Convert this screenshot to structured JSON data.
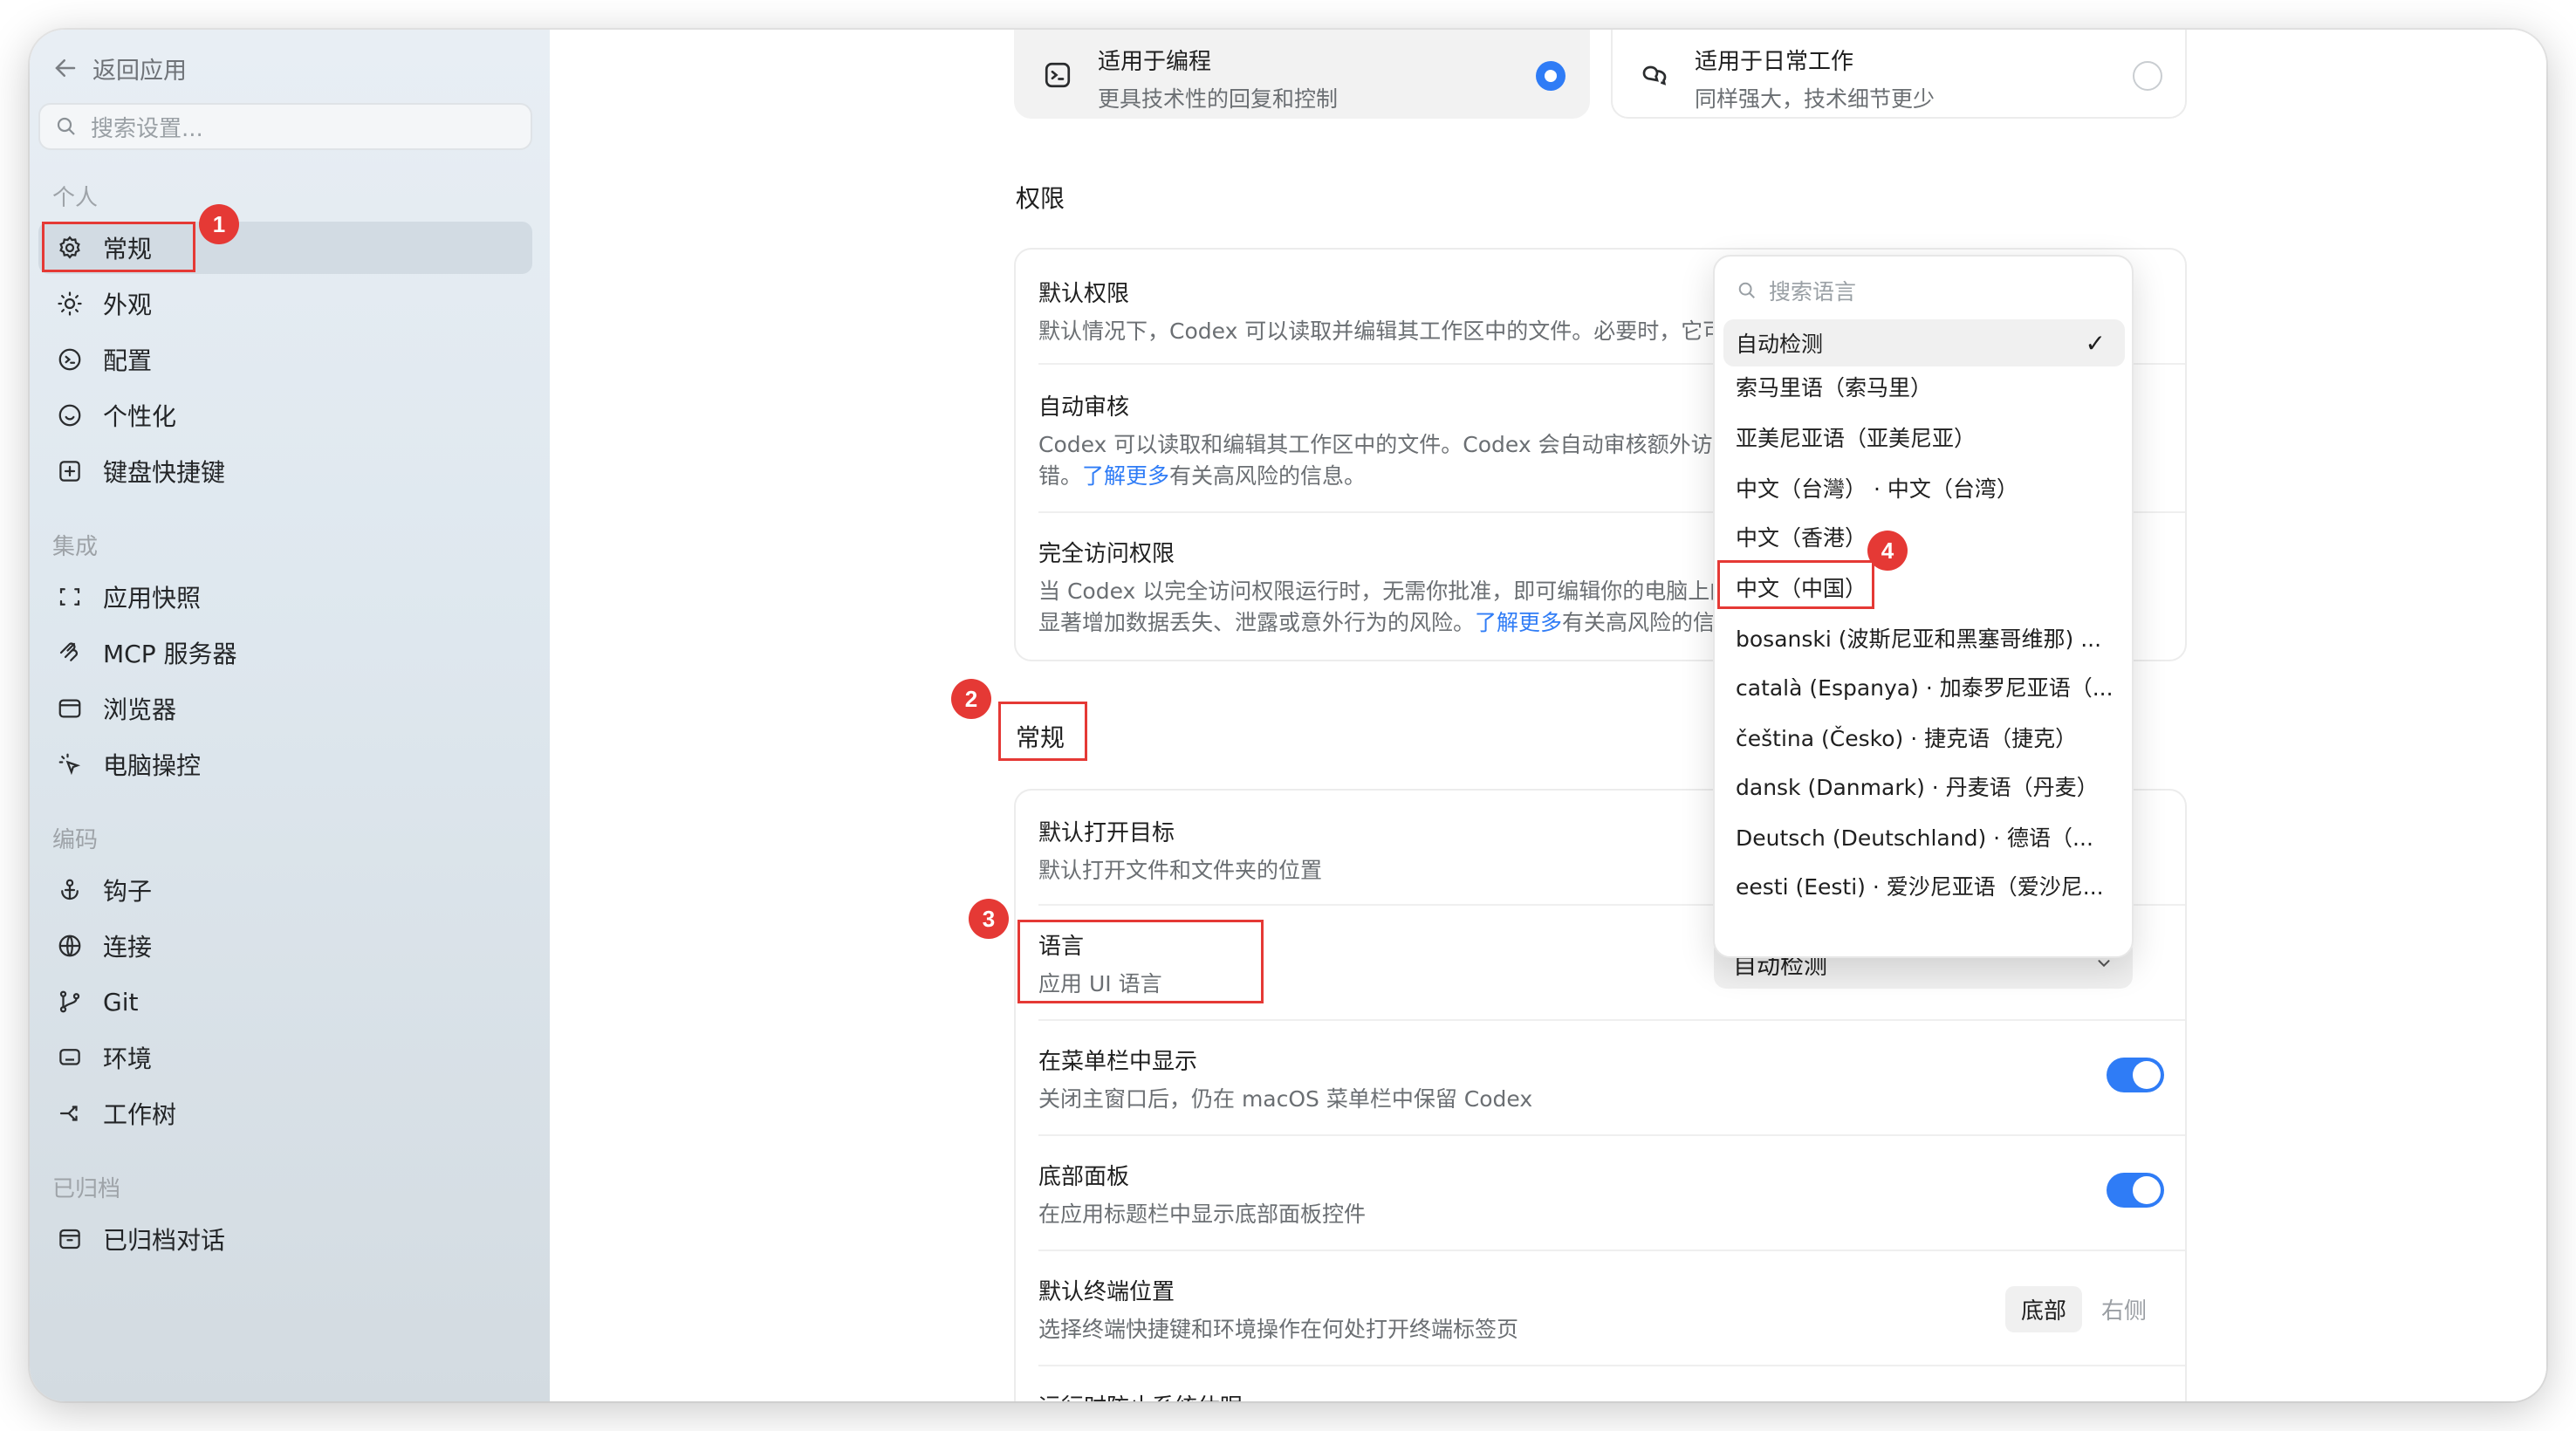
{
  "sidebar": {
    "back_label": "返回应用",
    "search_placeholder": "搜索设置...",
    "sections": {
      "personal": "个人",
      "integration": "集成",
      "coding": "编码",
      "archived": "已归档"
    },
    "items": {
      "general": "常规",
      "appearance": "外观",
      "config": "配置",
      "personalize": "个性化",
      "shortcuts": "键盘快捷键",
      "snapshots": "应用快照",
      "mcp": "MCP 服务器",
      "browser": "浏览器",
      "computer": "电脑操控",
      "hooks": "钩子",
      "connect": "连接",
      "git": "Git",
      "env": "环境",
      "worktree": "工作树",
      "archived_chats": "已归档对话"
    }
  },
  "mode_options": {
    "coding": {
      "title": "适用于编程",
      "desc": "更具技术性的回复和控制"
    },
    "daily": {
      "title": "适用于日常工作",
      "desc": "同样强大，技术细节更少"
    }
  },
  "permissions": {
    "heading": "权限",
    "default": {
      "title": "默认权限",
      "desc": "默认情况下，Codex 可以读取并编辑其工作区中的文件。必要时，它可"
    },
    "auto": {
      "title": "自动审核",
      "desc1": "Codex 可以读取和编辑其工作区中的文件。Codex 会自动审核额外访问",
      "desc2_pre": "错。",
      "link": "了解更多",
      "desc2_post": "有关高风险的信息。"
    },
    "full": {
      "title": "完全访问权限",
      "desc1": "当 Codex 以完全访问权限运行时，无需你批准，即可编辑你的电脑上的",
      "desc2_pre": "显著增加数据丢失、泄露或意外行为的风险。",
      "link": "了解更多",
      "desc2_post": "有关高风险的信息"
    }
  },
  "general": {
    "heading": "常规",
    "open_target": {
      "title": "默认打开目标",
      "desc": "默认打开文件和文件夹的位置"
    },
    "language": {
      "title": "语言",
      "desc": "应用 UI 语言",
      "value": "自动检测"
    },
    "menubar": {
      "title": "在菜单栏中显示",
      "desc": "关闭主窗口后，仍在 macOS 菜单栏中保留 Codex"
    },
    "bottom_panel": {
      "title": "底部面板",
      "desc": "在应用标题栏中显示底部面板控件"
    },
    "terminal": {
      "title": "默认终端位置",
      "desc": "选择终端快捷键和环境操作在何处打开终端标签页",
      "opt_bottom": "底部",
      "opt_right": "右侧"
    },
    "cut_row": "运行时防止系统休眠"
  },
  "language_dropdown": {
    "search_placeholder": "搜索语言",
    "options": [
      "自动检测",
      "索马里语（索马里）",
      "亚美尼亚语（亚美尼亚）",
      "中文（台灣） · 中文（台湾）",
      "中文（香港）",
      "中文（中国）",
      "bosanski (波斯尼亚和黑塞哥维那) ...",
      "català (Espanya) · 加泰罗尼亚语（...",
      "čeština (Česko) · 捷克语（捷克）",
      "dansk (Danmark) · 丹麦语（丹麦）",
      "Deutsch (Deutschland) · 德语（...",
      "eesti (Eesti) · 爱沙尼亚语（爱沙尼..."
    ],
    "check": "✓"
  },
  "annotations": {
    "b1": "1",
    "b2": "2",
    "b3": "3",
    "b4": "4"
  },
  "colors": {
    "accent": "#2f7cf6",
    "annotation": "#e53935"
  }
}
